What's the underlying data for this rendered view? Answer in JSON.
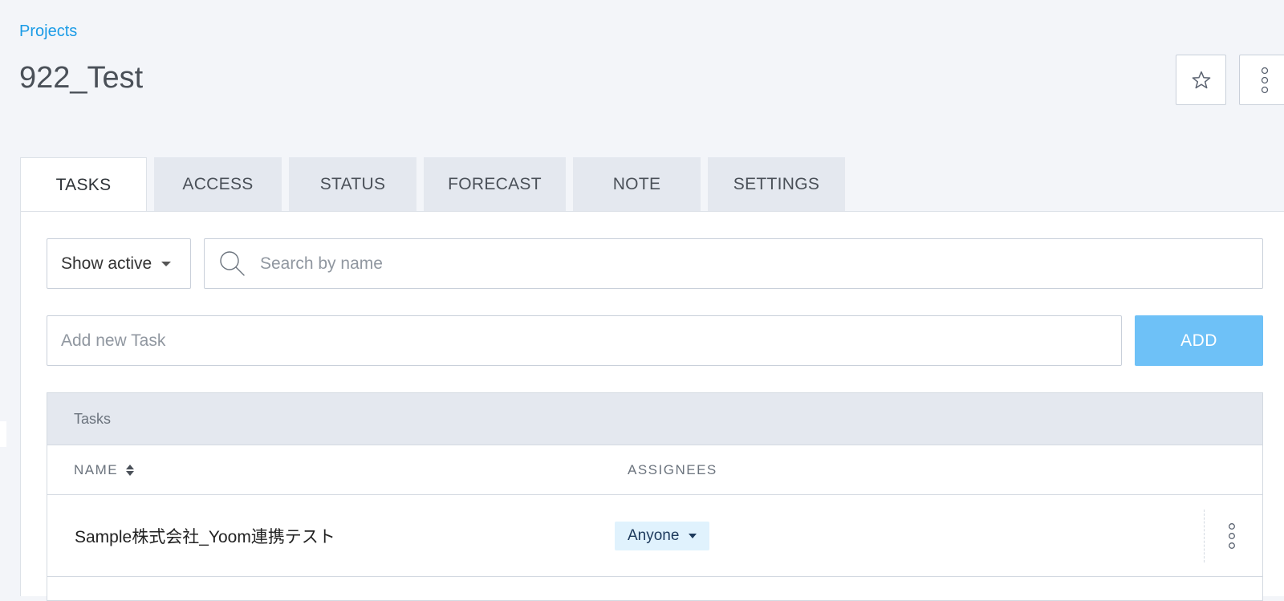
{
  "breadcrumb": {
    "label": "Projects"
  },
  "page": {
    "title": "922_Test"
  },
  "header_actions": {
    "favorite_icon": "star-icon",
    "more_icon": "vertical-dots-icon"
  },
  "tabs": [
    {
      "label": "TASKS",
      "active": true
    },
    {
      "label": "ACCESS",
      "active": false
    },
    {
      "label": "STATUS",
      "active": false
    },
    {
      "label": "FORECAST",
      "active": false
    },
    {
      "label": "NOTE",
      "active": false
    },
    {
      "label": "SETTINGS",
      "active": false
    }
  ],
  "filters": {
    "status_select_value": "Show active",
    "search_placeholder": "Search by name"
  },
  "add_task": {
    "placeholder": "Add new Task",
    "button_label": "ADD"
  },
  "table": {
    "caption": "Tasks",
    "columns": {
      "name": "NAME",
      "assignees": "ASSIGNEES"
    },
    "rows": [
      {
        "name": "Sample株式会社_Yoom連携テスト",
        "assignee": "Anyone"
      }
    ]
  },
  "colors": {
    "accent": "#1a9be6",
    "add_button": "#6ec1f7",
    "background": "#f3f5f9",
    "tab_inactive": "#e4e8ef",
    "badge": "#e0f2fd"
  }
}
